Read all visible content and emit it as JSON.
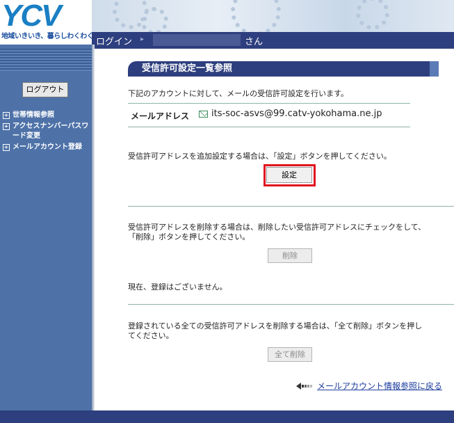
{
  "brand": {
    "logo": "YCV",
    "tagline": "地域いきいき、暮らしわくわく"
  },
  "topbar": {
    "login_label": "ログイン",
    "separator": "▸",
    "san": "さん"
  },
  "sidebar": {
    "logout_label": "ログアウト",
    "items": [
      {
        "label": "世帯情報参照"
      },
      {
        "label": "アクセスナンバーパスワード変更"
      },
      {
        "label": "メールアカウント登録"
      }
    ]
  },
  "main": {
    "title": "受信許可設定一覧参照",
    "intro": "下記のアカウントに対して、メールの受信許可設定を行います。",
    "mail_label": "メールアドレス",
    "mail_address": "its-soc-asvs@99.catv-yokohama.ne.jp",
    "add_instruction": "受信許可アドレスを追加設定する場合は、「設定」ボタンを押してください。",
    "setting_button": "設定",
    "delete_instruction_1": "受信許可アドレスを削除する場合は、削除したい受信許可アドレスにチェックをして、",
    "delete_instruction_2": "「削除」ボタンを押してください。",
    "delete_button": "削除",
    "no_registration": "現在、登録はございません。",
    "delete_all_instruction_1": "登録されている全ての受信許可アドレスを削除する場合は、「全て削除」ボタンを押し",
    "delete_all_instruction_2": "てください。",
    "delete_all_button": "全て削除",
    "back_link": "メールアカウント情報参照に戻る"
  },
  "colors": {
    "navy": "#2d3f7e",
    "sidebar": "#4e72a8",
    "highlight": "#e0141e",
    "link": "#1a3a9c"
  }
}
